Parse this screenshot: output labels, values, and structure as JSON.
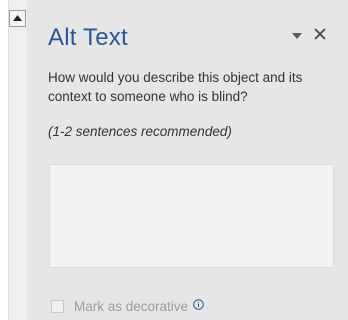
{
  "scrollbar": {
    "up_icon": "triangle-up-icon"
  },
  "pane": {
    "title": "Alt Text",
    "dropdown_icon": "chevron-down-icon",
    "close_icon": "close-icon",
    "prompt": "How would you describe this object and its context to someone who is blind?",
    "hint": "(1-2 sentences recommended)",
    "alt_text_value": "",
    "decorative": {
      "label": "Mark as decorative",
      "checked": false,
      "info_icon": "info-icon"
    }
  },
  "colors": {
    "title": "#2b579a",
    "background": "#e6e6e6",
    "info_icon": "#2b579a"
  }
}
